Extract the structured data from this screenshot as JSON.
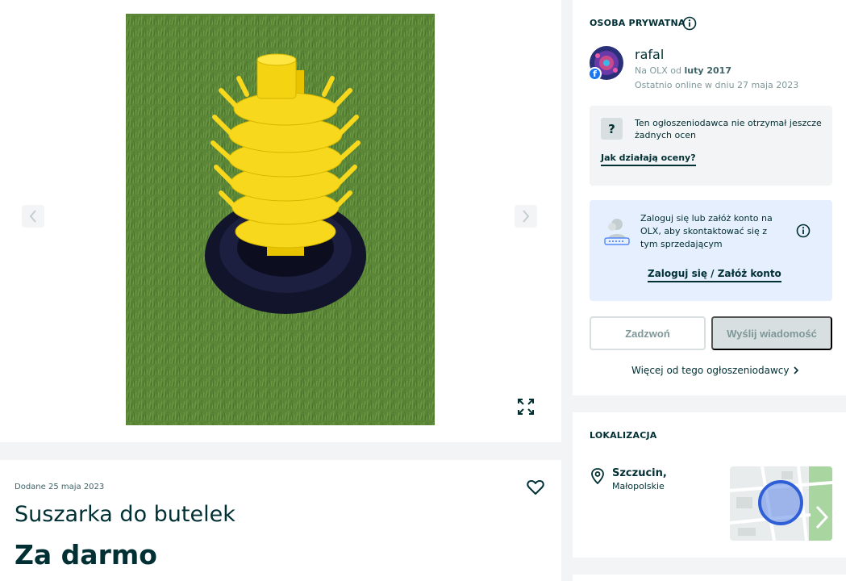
{
  "gallery": {
    "photo_alt": "Suszarka do butelek",
    "prev_icon": "chevron-left-icon",
    "next_icon": "chevron-right-icon",
    "expand_icon": "expand-icon"
  },
  "ad": {
    "added_date": "Dodane 25 maja 2023",
    "title": "Suszarka do butelek",
    "price": "Za darmo",
    "favorite_icon": "heart-icon"
  },
  "seller": {
    "heading": "OSOBA PRYWATNA",
    "name": "rafal",
    "member_prefix": "Na OLX od ",
    "member_since": "luty 2017",
    "last_online": "Ostatnio online w dniu 27 maja 2023",
    "fb_badge": "f",
    "ratings_icon": "?",
    "ratings_text": "Ten ogłoszeniodawca nie otrzymał jeszcze żadnych ocen",
    "ratings_link": "Jak działają oceny?",
    "login_text": "Zaloguj się lub załóż konto na OLX, aby skontaktować się z tym sprzedającym",
    "login_link": "Zaloguj się / Załóż konto",
    "call_button": "Zadzwoń",
    "message_button": "Wyślij wiadomość",
    "more_link": "Więcej od tego ogłoszeniodawcy"
  },
  "location": {
    "heading": "LOKALIZACJA",
    "city": "Szczucin,",
    "region": "Małopolskie"
  },
  "colors": {
    "primary_text": "#002f34",
    "muted_text": "#7f9799",
    "background": "#f2f4f5",
    "login_box": "#e6effe",
    "product_yellow": "#f7d81d"
  }
}
